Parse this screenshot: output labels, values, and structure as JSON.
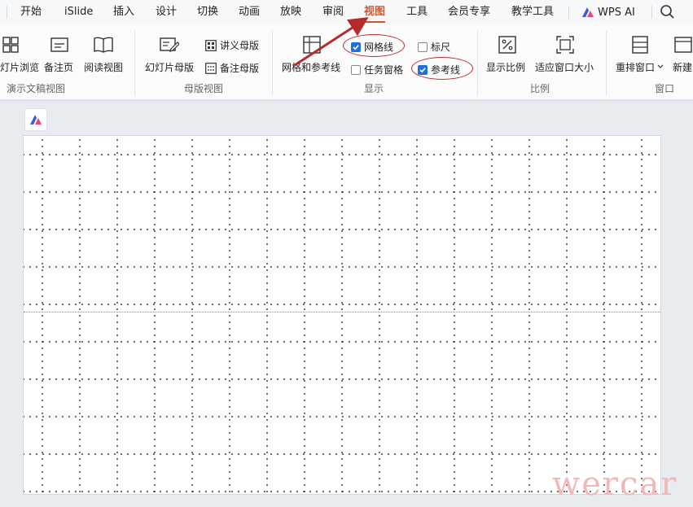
{
  "menu": {
    "items": [
      "开始",
      "iSlide",
      "插入",
      "设计",
      "切换",
      "动画",
      "放映",
      "审阅",
      "视图",
      "工具",
      "会员专享",
      "教学工具"
    ],
    "active": "视图",
    "wps_ai_label": "WPS AI"
  },
  "ribbon": {
    "groups": {
      "presentation_view": {
        "label": "演示文稿视图",
        "slide_browse": "灯片浏览",
        "notes_page": "备注页",
        "reading_view": "阅读视图"
      },
      "master_view": {
        "label": "母版视图",
        "slide_master": "幻灯片母版",
        "handout_master": "讲义母版",
        "notes_master": "备注母版"
      },
      "display": {
        "label": "显示",
        "grid_and_guides": "网格和参考线",
        "gridlines": "网格线",
        "gridlines_checked": true,
        "task_pane": "任务窗格",
        "task_pane_checked": false,
        "ruler": "标尺",
        "ruler_checked": false,
        "guides": "参考线",
        "guides_checked": true
      },
      "zoom": {
        "label": "比例",
        "zoom_ratio": "显示比例",
        "fit_window": "适应窗口大小"
      },
      "window": {
        "label": "窗口",
        "rearrange": "重排窗口",
        "new_window": "新建"
      }
    }
  },
  "watermark": "wercar",
  "colors": {
    "accent": "#d0572d",
    "annotation": "#b52a2a",
    "checkbox": "#1f6fe0"
  }
}
